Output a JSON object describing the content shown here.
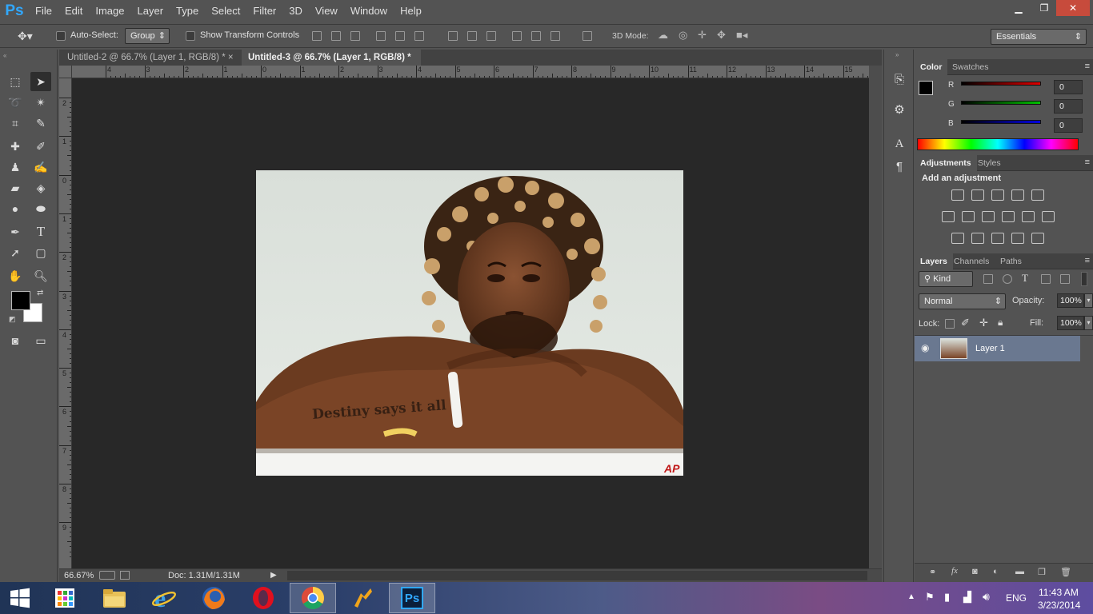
{
  "app": {
    "logo": "Ps"
  },
  "menu": [
    "File",
    "Edit",
    "Image",
    "Layer",
    "Type",
    "Select",
    "Filter",
    "3D",
    "View",
    "Window",
    "Help"
  ],
  "window_controls": {
    "minimize": "▁",
    "restore": "❐",
    "close": "✕"
  },
  "options_bar": {
    "auto_select_label": "Auto-Select:",
    "auto_select_value": "Group",
    "show_transform_label": "Show Transform Controls",
    "mode_3d_label": "3D Mode:",
    "workspace": "Essentials"
  },
  "tabs": [
    {
      "label": "Untitled-2 @ 66.7% (Layer 1, RGB/8) *",
      "close": "×"
    },
    {
      "label": "Untitled-3 @ 66.7% (Layer 1, RGB/8) *",
      "close": "×"
    }
  ],
  "ruler_h": [
    "4",
    "3",
    "2",
    "1",
    "0",
    "1",
    "2",
    "3",
    "4",
    "5",
    "6",
    "7",
    "8",
    "9",
    "10",
    "11",
    "12",
    "13",
    "14",
    "15"
  ],
  "ruler_v": [
    "2",
    "1",
    "0",
    "1",
    "2",
    "3",
    "4",
    "5",
    "6",
    "7",
    "8",
    "9"
  ],
  "image": {
    "tattoo_text": "Destiny says it all",
    "watermark": "AP"
  },
  "status": {
    "zoom": "66.67%",
    "doc": "Doc: 1.31M/1.31M",
    "arrow": "▶"
  },
  "color_panel": {
    "tabs": [
      "Color",
      "Swatches"
    ],
    "channels": [
      {
        "label": "R",
        "value": "0",
        "color": "#e00000"
      },
      {
        "label": "G",
        "value": "0",
        "color": "#00c000"
      },
      {
        "label": "B",
        "value": "0",
        "color": "#0000e0"
      }
    ]
  },
  "adjustments_panel": {
    "tabs": [
      "Adjustments",
      "Styles"
    ],
    "title": "Add an adjustment"
  },
  "layers_panel": {
    "tabs": [
      "Layers",
      "Channels",
      "Paths"
    ],
    "kind_label": "Kind",
    "blend_mode": "Normal",
    "opacity_label": "Opacity:",
    "opacity_value": "100%",
    "lock_label": "Lock:",
    "fill_label": "Fill:",
    "fill_value": "100%",
    "layer_name": "Layer 1"
  },
  "taskbar": {
    "language": "ENG",
    "time": "11:43 AM",
    "date": "3/23/2014",
    "ps_label": "Ps"
  }
}
